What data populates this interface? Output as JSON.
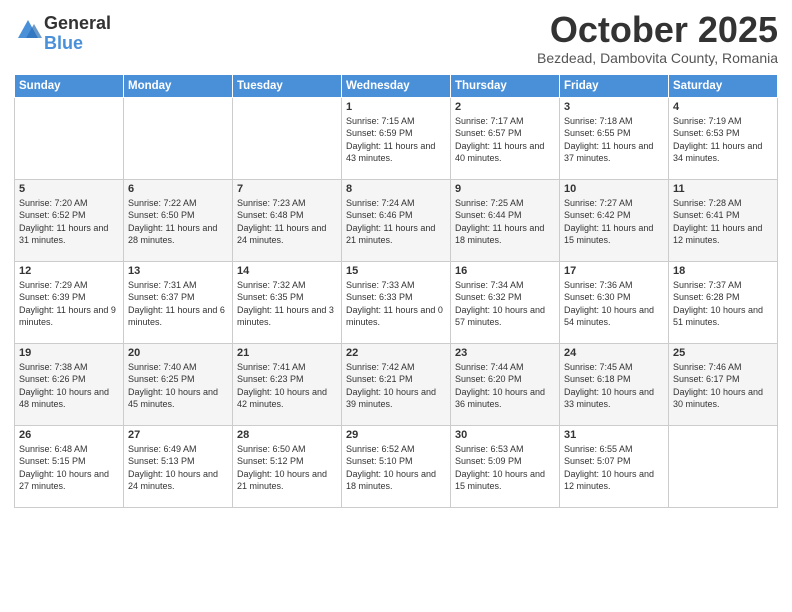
{
  "logo": {
    "general": "General",
    "blue": "Blue"
  },
  "header": {
    "month": "October 2025",
    "subtitle": "Bezdead, Dambovita County, Romania"
  },
  "weekdays": [
    "Sunday",
    "Monday",
    "Tuesday",
    "Wednesday",
    "Thursday",
    "Friday",
    "Saturday"
  ],
  "weeks": [
    [
      {
        "day": "",
        "info": ""
      },
      {
        "day": "",
        "info": ""
      },
      {
        "day": "",
        "info": ""
      },
      {
        "day": "1",
        "info": "Sunrise: 7:15 AM\nSunset: 6:59 PM\nDaylight: 11 hours and 43 minutes."
      },
      {
        "day": "2",
        "info": "Sunrise: 7:17 AM\nSunset: 6:57 PM\nDaylight: 11 hours and 40 minutes."
      },
      {
        "day": "3",
        "info": "Sunrise: 7:18 AM\nSunset: 6:55 PM\nDaylight: 11 hours and 37 minutes."
      },
      {
        "day": "4",
        "info": "Sunrise: 7:19 AM\nSunset: 6:53 PM\nDaylight: 11 hours and 34 minutes."
      }
    ],
    [
      {
        "day": "5",
        "info": "Sunrise: 7:20 AM\nSunset: 6:52 PM\nDaylight: 11 hours and 31 minutes."
      },
      {
        "day": "6",
        "info": "Sunrise: 7:22 AM\nSunset: 6:50 PM\nDaylight: 11 hours and 28 minutes."
      },
      {
        "day": "7",
        "info": "Sunrise: 7:23 AM\nSunset: 6:48 PM\nDaylight: 11 hours and 24 minutes."
      },
      {
        "day": "8",
        "info": "Sunrise: 7:24 AM\nSunset: 6:46 PM\nDaylight: 11 hours and 21 minutes."
      },
      {
        "day": "9",
        "info": "Sunrise: 7:25 AM\nSunset: 6:44 PM\nDaylight: 11 hours and 18 minutes."
      },
      {
        "day": "10",
        "info": "Sunrise: 7:27 AM\nSunset: 6:42 PM\nDaylight: 11 hours and 15 minutes."
      },
      {
        "day": "11",
        "info": "Sunrise: 7:28 AM\nSunset: 6:41 PM\nDaylight: 11 hours and 12 minutes."
      }
    ],
    [
      {
        "day": "12",
        "info": "Sunrise: 7:29 AM\nSunset: 6:39 PM\nDaylight: 11 hours and 9 minutes."
      },
      {
        "day": "13",
        "info": "Sunrise: 7:31 AM\nSunset: 6:37 PM\nDaylight: 11 hours and 6 minutes."
      },
      {
        "day": "14",
        "info": "Sunrise: 7:32 AM\nSunset: 6:35 PM\nDaylight: 11 hours and 3 minutes."
      },
      {
        "day": "15",
        "info": "Sunrise: 7:33 AM\nSunset: 6:33 PM\nDaylight: 11 hours and 0 minutes."
      },
      {
        "day": "16",
        "info": "Sunrise: 7:34 AM\nSunset: 6:32 PM\nDaylight: 10 hours and 57 minutes."
      },
      {
        "day": "17",
        "info": "Sunrise: 7:36 AM\nSunset: 6:30 PM\nDaylight: 10 hours and 54 minutes."
      },
      {
        "day": "18",
        "info": "Sunrise: 7:37 AM\nSunset: 6:28 PM\nDaylight: 10 hours and 51 minutes."
      }
    ],
    [
      {
        "day": "19",
        "info": "Sunrise: 7:38 AM\nSunset: 6:26 PM\nDaylight: 10 hours and 48 minutes."
      },
      {
        "day": "20",
        "info": "Sunrise: 7:40 AM\nSunset: 6:25 PM\nDaylight: 10 hours and 45 minutes."
      },
      {
        "day": "21",
        "info": "Sunrise: 7:41 AM\nSunset: 6:23 PM\nDaylight: 10 hours and 42 minutes."
      },
      {
        "day": "22",
        "info": "Sunrise: 7:42 AM\nSunset: 6:21 PM\nDaylight: 10 hours and 39 minutes."
      },
      {
        "day": "23",
        "info": "Sunrise: 7:44 AM\nSunset: 6:20 PM\nDaylight: 10 hours and 36 minutes."
      },
      {
        "day": "24",
        "info": "Sunrise: 7:45 AM\nSunset: 6:18 PM\nDaylight: 10 hours and 33 minutes."
      },
      {
        "day": "25",
        "info": "Sunrise: 7:46 AM\nSunset: 6:17 PM\nDaylight: 10 hours and 30 minutes."
      }
    ],
    [
      {
        "day": "26",
        "info": "Sunrise: 6:48 AM\nSunset: 5:15 PM\nDaylight: 10 hours and 27 minutes."
      },
      {
        "day": "27",
        "info": "Sunrise: 6:49 AM\nSunset: 5:13 PM\nDaylight: 10 hours and 24 minutes."
      },
      {
        "day": "28",
        "info": "Sunrise: 6:50 AM\nSunset: 5:12 PM\nDaylight: 10 hours and 21 minutes."
      },
      {
        "day": "29",
        "info": "Sunrise: 6:52 AM\nSunset: 5:10 PM\nDaylight: 10 hours and 18 minutes."
      },
      {
        "day": "30",
        "info": "Sunrise: 6:53 AM\nSunset: 5:09 PM\nDaylight: 10 hours and 15 minutes."
      },
      {
        "day": "31",
        "info": "Sunrise: 6:55 AM\nSunset: 5:07 PM\nDaylight: 10 hours and 12 minutes."
      },
      {
        "day": "",
        "info": ""
      }
    ]
  ]
}
